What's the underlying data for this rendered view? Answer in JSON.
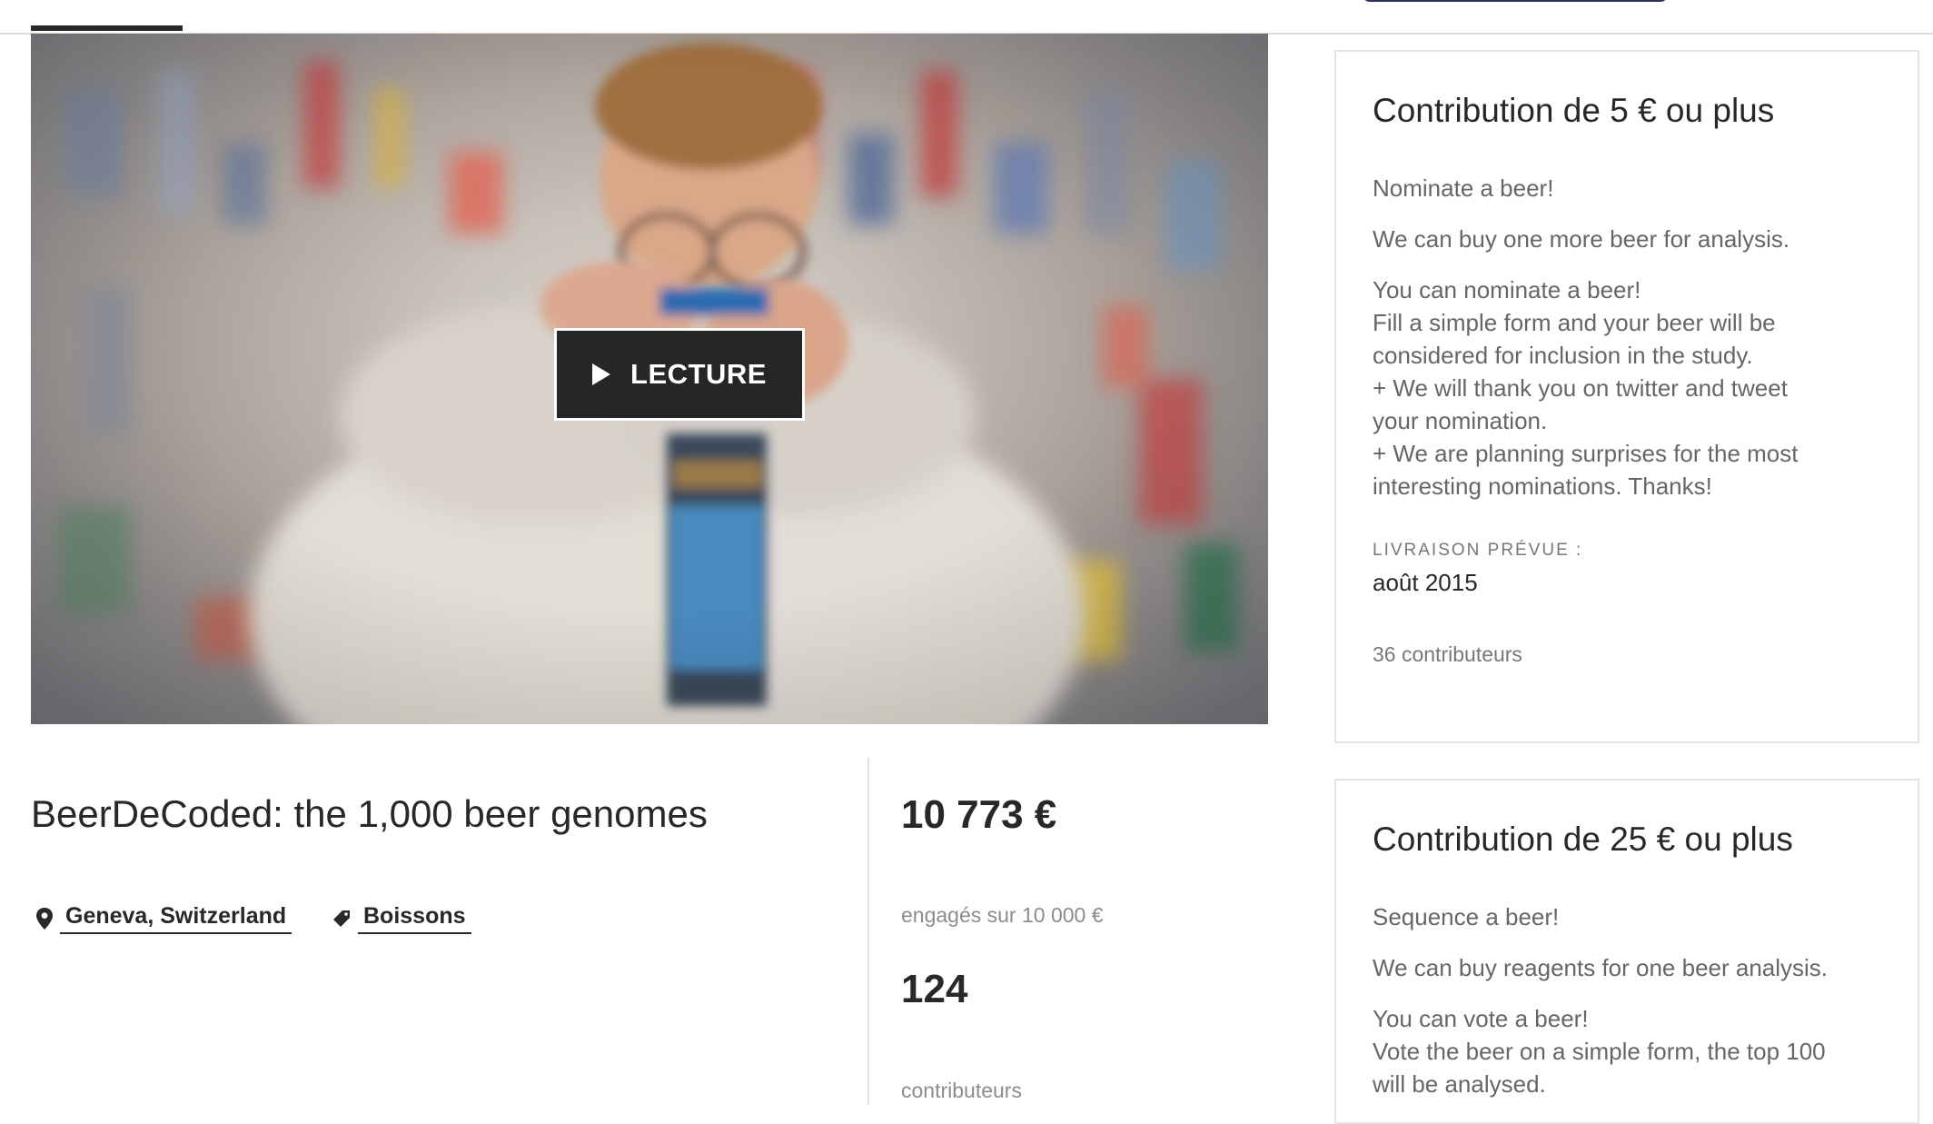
{
  "video": {
    "play_label": "LECTURE"
  },
  "project": {
    "title": "BeerDeCoded: the 1,000 beer genomes",
    "location": "Geneva, Switzerland",
    "category": "Boissons"
  },
  "stats": {
    "pledged": "10 773 €",
    "pledged_caption": "engagés sur 10 000 €",
    "backers": "124",
    "backers_caption": "contributeurs"
  },
  "rewards": [
    {
      "title": "Contribution de 5 € ou plus",
      "name": "Nominate a beer!",
      "summary": "We can buy one more beer for analysis.",
      "lines": [
        "You can nominate a beer!",
        "Fill a simple form and your beer will be",
        "considered for inclusion in the study.",
        "+ We will thank you on twitter and tweet",
        "your nomination.",
        "+ We are planning surprises for the most",
        "interesting nominations. Thanks!"
      ],
      "delivery_label": "LIVRAISON PRÉVUE :",
      "delivery_date": "août 2015",
      "backers": "36 contributeurs"
    },
    {
      "title": "Contribution de 25 € ou plus",
      "name": "Sequence a beer!",
      "summary": "We can buy reagents for one beer analysis.",
      "lines": [
        "You can vote a beer!",
        "Vote the beer on a simple form, the top 100",
        "will be analysed."
      ]
    }
  ]
}
